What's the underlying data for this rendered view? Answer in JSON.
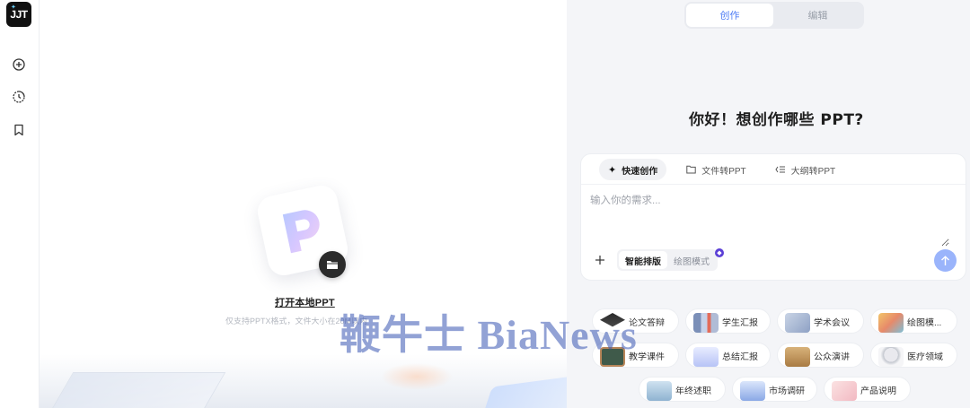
{
  "app": {
    "logo_text": "JJT"
  },
  "sidebar": {
    "items": [
      {
        "icon": "plus-circle-icon"
      },
      {
        "icon": "history-icon"
      },
      {
        "icon": "bookmark-icon"
      }
    ]
  },
  "workspace": {
    "open_local_label": "打开本地PPT",
    "hint": "仅支持PPTX格式，文件大小在20M以内"
  },
  "panel": {
    "mode_tabs": [
      {
        "label": "创作",
        "active": true
      },
      {
        "label": "编辑",
        "active": false
      }
    ],
    "greeting": "你好！想创作哪些 PPT?",
    "composer": {
      "tabs": [
        {
          "label": "快速创作",
          "icon": "sparkle-icon",
          "active": true
        },
        {
          "label": "文件转PPT",
          "icon": "folder-icon",
          "active": false
        },
        {
          "label": "大纲转PPT",
          "icon": "outline-icon",
          "active": false
        }
      ],
      "placeholder": "输入你的需求...",
      "layout_options": [
        {
          "label": "智能排版",
          "active": true
        },
        {
          "label": "绘图模式",
          "active": false
        }
      ]
    },
    "chips": [
      {
        "label": "论文答辩",
        "icon": "graduation-cap-icon"
      },
      {
        "label": "学生汇报",
        "icon": "books-icon"
      },
      {
        "label": "学术会议",
        "icon": "microscope-icon"
      },
      {
        "label": "绘图模...",
        "icon": "palette-icon"
      },
      {
        "label": "教学课件",
        "icon": "blackboard-icon"
      },
      {
        "label": "总结汇报",
        "icon": "chart-icon"
      },
      {
        "label": "公众演讲",
        "icon": "podium-icon"
      },
      {
        "label": "医疗领域",
        "icon": "stethoscope-icon"
      },
      {
        "label": "年终述职",
        "icon": "document-stack-icon"
      },
      {
        "label": "市场调研",
        "icon": "laptop-chart-icon"
      },
      {
        "label": "产品说明",
        "icon": "product-box-icon"
      }
    ]
  },
  "watermark": "鞭牛士 BiaNews",
  "colors": {
    "accent": "#4f7df5",
    "send_button": "#9ab4fb",
    "vip": "#5b3fd6"
  }
}
